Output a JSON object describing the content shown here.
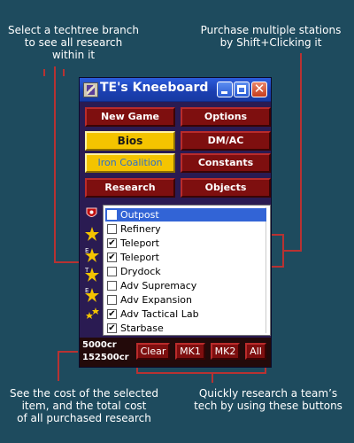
{
  "annotations": {
    "top_left": "Select a techtree branch\nto see all research\nwithin it",
    "top_right": "Purchase multiple stations\nby Shift+Clicking it",
    "bottom_left": "See the cost of the selected\nitem, and the total cost\nof all purchased research",
    "bottom_right": "Quickly research a team’s\ntech by using these buttons"
  },
  "window": {
    "title": "TE's Kneeboard"
  },
  "buttons": {
    "new_game": "New Game",
    "options": "Options",
    "bios": "Bios",
    "dmac": "DM/AC",
    "iron_coalition": "Iron Coalition",
    "constants": "Constants",
    "research": "Research",
    "objects": "Objects"
  },
  "research_list": [
    {
      "label": "Outpost",
      "checked": false,
      "selected": true
    },
    {
      "label": "Refinery",
      "checked": false,
      "selected": false
    },
    {
      "label": "Teleport",
      "checked": true,
      "selected": false
    },
    {
      "label": "Teleport",
      "checked": true,
      "selected": false
    },
    {
      "label": "Drydock",
      "checked": false,
      "selected": false
    },
    {
      "label": "Adv Supremacy",
      "checked": false,
      "selected": false
    },
    {
      "label": "Adv Expansion",
      "checked": false,
      "selected": false
    },
    {
      "label": "Adv Tactical Lab",
      "checked": true,
      "selected": false
    },
    {
      "label": "Starbase",
      "checked": true,
      "selected": false
    }
  ],
  "costs": {
    "selected": "5000cr",
    "total": "152500cr"
  },
  "quick_buttons": {
    "clear": "Clear",
    "mk1": "MK1",
    "mk2": "MK2",
    "all": "All"
  },
  "branch_icons": [
    "shield-icon",
    "star-icon",
    "star-e-icon",
    "star-t-icon",
    "star-e-icon",
    "stars-cluster-icon"
  ],
  "colors": {
    "background": "#1e4b5e",
    "callout_line": "#b83232",
    "button_red": "#7e0f0f",
    "button_yellow": "#f4c400",
    "selection_blue": "#3264d6"
  }
}
